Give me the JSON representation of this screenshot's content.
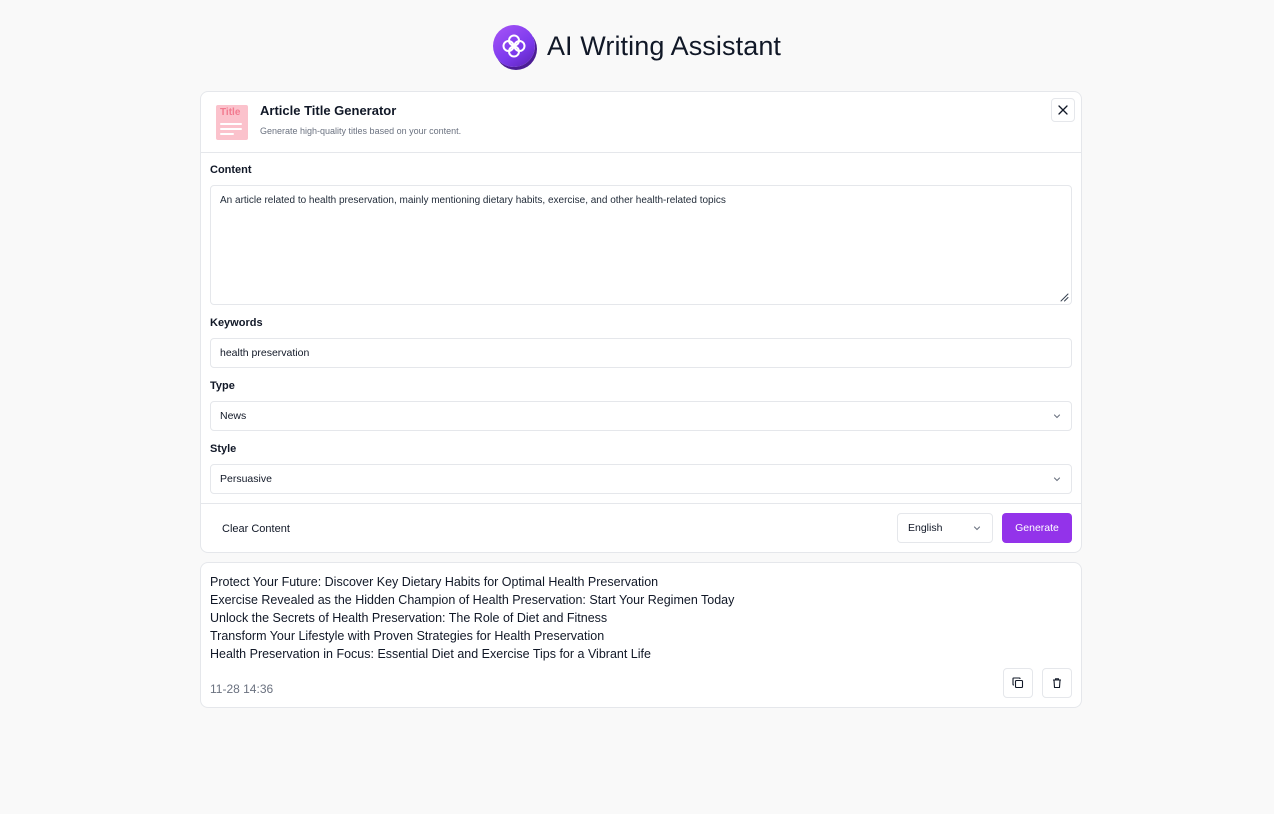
{
  "app": {
    "title": "AI Writing Assistant",
    "accent_color": "#9333ea"
  },
  "tool": {
    "icon_text": "Title",
    "title": "Article Title Generator",
    "description": "Generate high-quality titles based on your content.",
    "close_icon": "close-icon"
  },
  "form": {
    "content_label": "Content",
    "content_value": "An article related to health preservation, mainly mentioning dietary habits, exercise, and other health-related topics",
    "keywords_label": "Keywords",
    "keywords_value": "health preservation",
    "type_label": "Type",
    "type_value": "News",
    "style_label": "Style",
    "style_value": "Persuasive"
  },
  "footer": {
    "clear_label": "Clear Content",
    "language_value": "English",
    "generate_label": "Generate"
  },
  "result": {
    "lines": [
      "Protect Your Future: Discover Key Dietary Habits for Optimal Health Preservation",
      "Exercise Revealed as the Hidden Champion of Health Preservation: Start Your Regimen Today",
      "Unlock the Secrets of Health Preservation: The Role of Diet and Fitness",
      "Transform Your Lifestyle with Proven Strategies for Health Preservation",
      "Health Preservation in Focus: Essential Diet and Exercise Tips for a Vibrant Life"
    ],
    "timestamp": "11-28 14:36",
    "copy_icon": "copy-icon",
    "delete_icon": "trash-icon"
  }
}
